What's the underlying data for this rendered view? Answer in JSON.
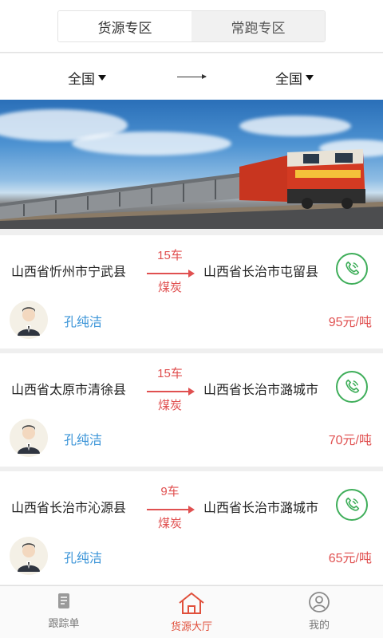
{
  "tabs": [
    {
      "label": "货源专区",
      "active": true
    },
    {
      "label": "常跑专区",
      "active": false
    }
  ],
  "filter": {
    "from": "全国",
    "to": "全国"
  },
  "listings": [
    {
      "from": "山西省忻州市宁武县",
      "to": "山西省长治市屯留县",
      "count": "15车",
      "cargo": "煤炭",
      "person": "孔纯洁",
      "price": "95元/吨"
    },
    {
      "from": "山西省太原市清徐县",
      "to": "山西省长治市潞城市",
      "count": "15车",
      "cargo": "煤炭",
      "person": "孔纯洁",
      "price": "70元/吨"
    },
    {
      "from": "山西省长治市沁源县",
      "to": "山西省长治市潞城市",
      "count": "9车",
      "cargo": "煤炭",
      "person": "孔纯洁",
      "price": "65元/吨"
    }
  ],
  "nav": [
    {
      "label": "跟踪单",
      "icon": "document-icon",
      "active": false
    },
    {
      "label": "货源大厅",
      "icon": "home-icon",
      "active": true
    },
    {
      "label": "我的",
      "icon": "user-icon",
      "active": false
    }
  ],
  "colors": {
    "accent": "#e05050",
    "link": "#3c95d8",
    "phone": "#3fae5a"
  }
}
